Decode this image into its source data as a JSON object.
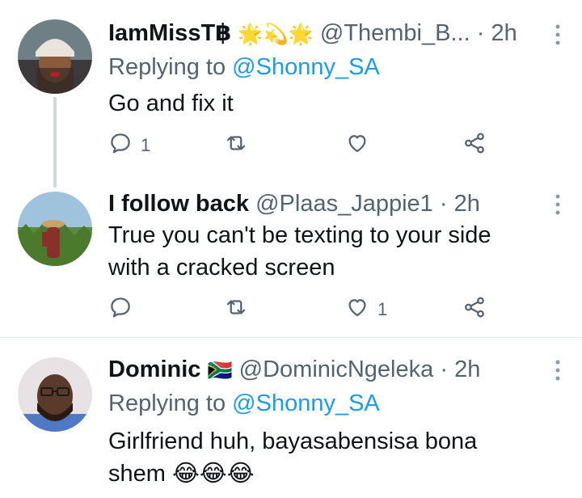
{
  "tweets": [
    {
      "name": "IamMissT฿",
      "emojis": "🌟💫🌟",
      "handle": "@Thembi_B...",
      "separator": "·",
      "time": "2h",
      "replying_prefix": "Replying to",
      "replying_to": "@Shonny_SA",
      "text": "Go and fix it",
      "reply_count": "1",
      "retweet_count": "",
      "like_count": ""
    },
    {
      "name": "I follow back",
      "emojis": "",
      "handle": "@Plaas_Jappie1",
      "separator": "·",
      "time": "2h",
      "text_line1": "True you can't be texting to your side",
      "text_line2": "with a cracked screen",
      "reply_count": "",
      "retweet_count": "",
      "like_count": "1"
    },
    {
      "name": "Dominic",
      "emojis": "🇿🇦",
      "handle": "@DominicNgeleka",
      "separator": "·",
      "time": "2h",
      "replying_prefix": "Replying to",
      "replying_to": "@Shonny_SA",
      "text_line1": "Girlfriend huh, bayasabensisa bona",
      "text_line2": "shem 😂😂😂"
    }
  ],
  "icons": {
    "reply": "reply-icon",
    "retweet": "retweet-icon",
    "like": "heart-icon",
    "share": "share-icon",
    "more": "more-icon"
  },
  "colors": {
    "link": "#1d9bf0",
    "secondary_text": "#536471",
    "thread_line": "#cfd9de"
  }
}
